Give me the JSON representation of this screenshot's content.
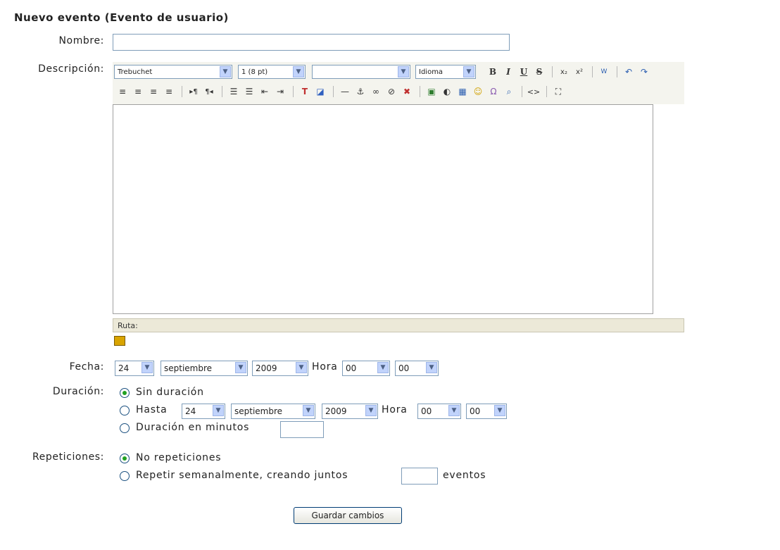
{
  "title": "Nuevo evento (Evento de usuario)",
  "labels": {
    "nombre": "Nombre:",
    "descripcion": "Descripción:",
    "fecha": "Fecha:",
    "duracion": "Duración:",
    "repeticiones": "Repeticiones:"
  },
  "nombre_value": "",
  "toolbar": {
    "font": "Trebuchet",
    "size": "1 (8 pt)",
    "style": "",
    "lang": "Idioma",
    "row1_icons": [
      "bold-icon",
      "italic-icon",
      "underline-icon",
      "strikethrough-icon",
      "subscript-icon",
      "superscript-icon",
      "clean-word-icon",
      "undo-icon",
      "redo-icon"
    ],
    "row2_icons": [
      "align-left-icon",
      "align-center-icon",
      "align-right-icon",
      "justify-icon",
      "ltr-icon",
      "rtl-icon",
      "ordered-list-icon",
      "unordered-list-icon",
      "outdent-icon",
      "indent-icon",
      "text-color-icon",
      "bg-color-icon",
      "hr-icon",
      "anchor-icon",
      "link-icon",
      "unlink-icon",
      "nolink-icon",
      "image-icon",
      "media-icon",
      "table-icon",
      "smiley-icon",
      "special-char-icon",
      "search-replace-icon",
      "html-source-icon",
      "fullscreen-icon"
    ]
  },
  "path_label": "Ruta:",
  "fecha": {
    "day": "24",
    "month": "septiembre",
    "year": "2009",
    "hora_label": "Hora",
    "hour": "00",
    "minute": "00"
  },
  "duracion": {
    "opt1": "Sin duración",
    "opt2": "Hasta",
    "hasta": {
      "day": "24",
      "month": "septiembre",
      "year": "2009",
      "hora_label": "Hora",
      "hour": "00",
      "minute": "00"
    },
    "opt3": "Duración en minutos",
    "minutes_value": "",
    "selected": "Sin duración"
  },
  "repeticiones": {
    "opt1": "No repeticiones",
    "opt2": "Repetir semanalmente, creando juntos",
    "opt2_suffix": "eventos",
    "count_value": "",
    "selected": "No repeticiones"
  },
  "submit_label": "Guardar cambios"
}
